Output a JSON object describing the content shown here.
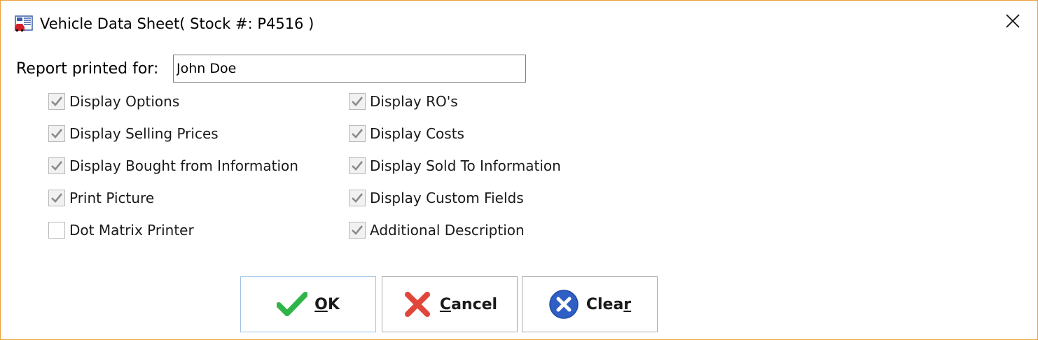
{
  "window": {
    "title": "Vehicle Data Sheet( Stock #: P4516 )",
    "app_icon": "vehicle-datasheet-icon",
    "close_icon": "close-icon"
  },
  "report": {
    "label": "Report printed for:",
    "value": "John Doe"
  },
  "options_left": [
    {
      "label": "Display Options",
      "checked": true
    },
    {
      "label": "Display Selling Prices",
      "checked": true
    },
    {
      "label": "Display Bought from Information",
      "checked": true
    },
    {
      "label": "Print Picture",
      "checked": true
    },
    {
      "label": "Dot Matrix Printer",
      "checked": false
    }
  ],
  "options_right": [
    {
      "label": "Display RO's",
      "checked": true
    },
    {
      "label": "Display Costs",
      "checked": true
    },
    {
      "label": "Display Sold To Information",
      "checked": true
    },
    {
      "label": "Display Custom Fields",
      "checked": true
    },
    {
      "label": "Additional Description",
      "checked": true
    }
  ],
  "buttons": {
    "ok": {
      "mnemonic": "O",
      "rest": "K",
      "icon": "checkmark-icon"
    },
    "cancel": {
      "mnemonic": "C",
      "rest": "ancel",
      "icon": "red-x-icon"
    },
    "clear": {
      "lead": "Clea",
      "mnemonic": "r",
      "icon": "blue-circle-x-icon"
    }
  },
  "colors": {
    "window_border": "#e8a23a",
    "ok_icon": "#2fb54a",
    "cancel_icon": "#e0463a",
    "clear_icon": "#2f5fc4",
    "default_button_border": "#9cc2e6"
  }
}
